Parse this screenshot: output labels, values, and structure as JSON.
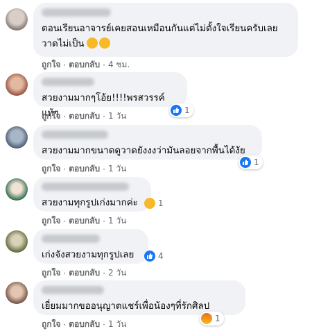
{
  "comments": [
    {
      "text": "ตอนเรียนอาจารย์เคยสอนเหมือนกันแต่ไม่ตั้งใจเรียนครับเลยวาดไม่เป็น",
      "like": "ถูกใจ",
      "reply": "ตอบกลับ",
      "time": "4 ชม.",
      "reaction": null
    },
    {
      "text": "สวยงามมากๆโอ้ย!!!!พรสวรรค์แท้ๆ",
      "like": "ถูกใจ",
      "reply": "ตอบกลับ",
      "time": "1 วัน",
      "reaction": {
        "type": "like-icon",
        "count": "1"
      }
    },
    {
      "text": "สวยงามมากขนาดดูวาดยังงงว่ามันลอยจากพื้นได้งัย",
      "like": "ถูกใจ",
      "reply": "ตอบกลับ",
      "time": "1 วัน",
      "reaction": {
        "type": "like-icon",
        "count": "1"
      }
    },
    {
      "text": "สวยงามทุกรูปเก่งมากค่ะ",
      "like": "ถูกใจ",
      "reply": "ตอบกลับ",
      "time": "1 วัน",
      "reaction": {
        "type": "care-icon",
        "count": "1"
      }
    },
    {
      "text": "เก่งจังสวยงามทุกรูปเลย",
      "like": "ถูกใจ",
      "reply": "ตอบกลับ",
      "time": "2 วัน",
      "reaction": {
        "type": "like-icon",
        "count": "4"
      }
    },
    {
      "text": "เยี่ยมมากขออนุญาตแชร์เพื่อน้องๆที่รักศิลป",
      "like": "ถูกใจ",
      "reply": "ตอบกลับ",
      "time": "1 วัน",
      "reaction": {
        "type": "angry-icon",
        "count": "1"
      }
    }
  ],
  "colors": {
    "bubble": "#f0f2f5",
    "meta": "#65676b",
    "like": "#1877f2"
  }
}
